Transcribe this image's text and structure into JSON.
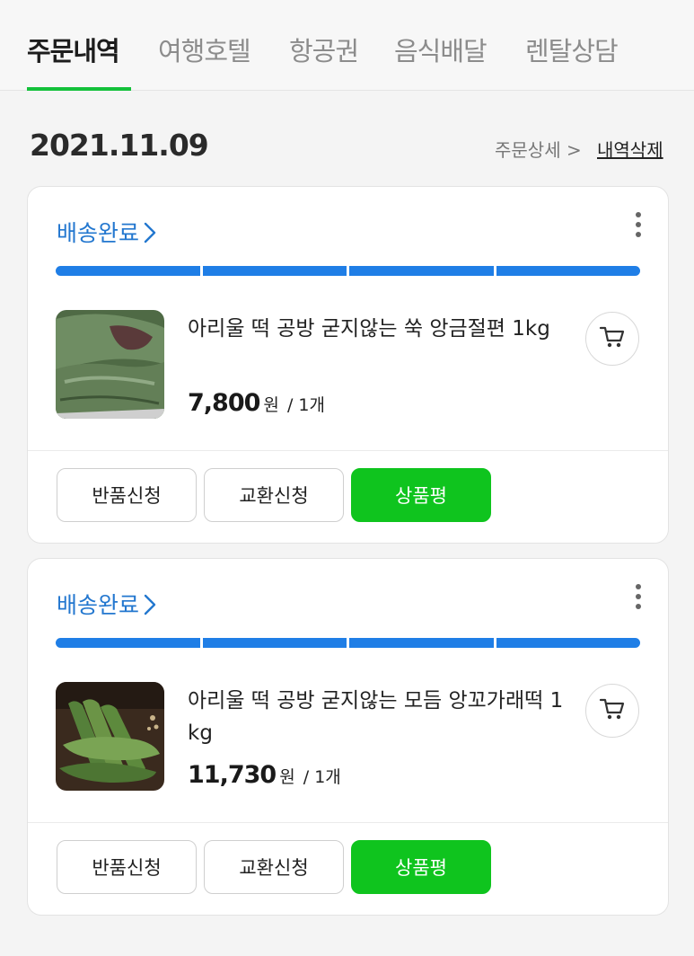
{
  "tabs": [
    {
      "label": "주문내역",
      "active": true
    },
    {
      "label": "여행호텔",
      "active": false
    },
    {
      "label": "항공권",
      "active": false
    },
    {
      "label": "음식배달",
      "active": false
    },
    {
      "label": "렌탈상담",
      "active": false
    }
  ],
  "order_group": {
    "date": "2021.11.09",
    "order_detail_link": "주문상세 >",
    "delete_history_link": "내역삭제"
  },
  "orders": [
    {
      "status": "배송완료",
      "progress_steps_completed": 4,
      "progress_steps_total": 4,
      "product_name": "아리울 떡 공방 굳지않는 쑥 앙금절편 1kg",
      "price": "7,800",
      "currency": "원",
      "quantity": "/ 1개",
      "buttons": {
        "return": "반품신청",
        "exchange": "교환신청",
        "review": "상품평"
      }
    },
    {
      "status": "배송완료",
      "progress_steps_completed": 4,
      "progress_steps_total": 4,
      "product_name": "아리울 떡 공방 굳지않는 모듬 앙꼬가래떡 1kg",
      "price": "11,730",
      "currency": "원",
      "quantity": "/ 1개",
      "buttons": {
        "return": "반품신청",
        "exchange": "교환신청",
        "review": "상품평"
      }
    }
  ],
  "icons": {
    "status_chevron": "chevron-right-icon",
    "more": "more-vertical-icon",
    "cart": "cart-icon"
  },
  "colors": {
    "accent_green": "#0fc41e",
    "tab_underline": "#13c13a",
    "status_blue": "#2377cf",
    "progress_blue": "#1f7ee6"
  }
}
